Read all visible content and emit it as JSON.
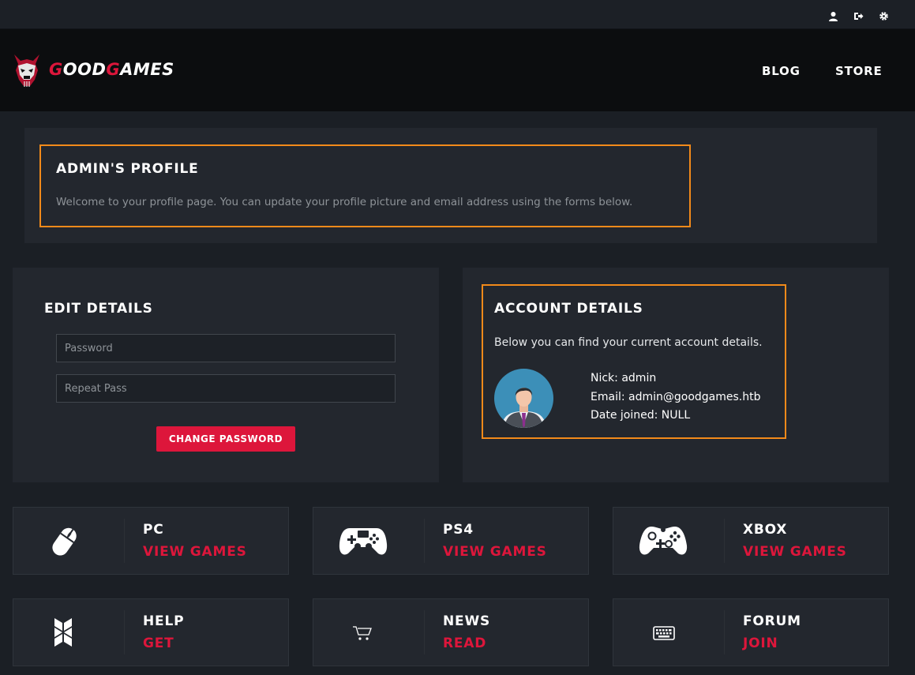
{
  "topbar": {
    "icons": [
      "user-icon",
      "logout-icon",
      "gear-icon"
    ]
  },
  "header": {
    "logo_text_1": "G",
    "logo_text_2": "OOD",
    "logo_text_3": "G",
    "logo_text_4": "AMES",
    "nav": [
      {
        "label": "BLOG"
      },
      {
        "label": "STORE"
      }
    ]
  },
  "profile": {
    "title": "ADMIN'S PROFILE",
    "welcome": "Welcome to your profile page. You can update your profile picture and email address using the forms below."
  },
  "edit": {
    "title": "EDIT DETAILS",
    "password_placeholder": "Password",
    "repeat_placeholder": "Repeat Pass",
    "button": "CHANGE PASSWORD"
  },
  "account": {
    "title": "ACCOUNT DETAILS",
    "subtitle": "Below you can find your current account details.",
    "nick": "Nick: admin",
    "email": "Email: admin@goodgames.htb",
    "joined": "Date joined: NULL"
  },
  "tiles": [
    {
      "title": "PC",
      "action": "VIEW GAMES",
      "icon": "mouse-icon"
    },
    {
      "title": "PS4",
      "action": "VIEW GAMES",
      "icon": "ps4-controller-icon"
    },
    {
      "title": "XBOX",
      "action": "VIEW GAMES",
      "icon": "xbox-controller-icon"
    },
    {
      "title": "HELP",
      "action": "GET",
      "icon": "help-icon"
    },
    {
      "title": "NEWS",
      "action": "READ",
      "icon": "cart-icon"
    },
    {
      "title": "FORUM",
      "action": "JOIN",
      "icon": "keyboard-icon"
    }
  ],
  "colors": {
    "accent": "#dd163b",
    "highlight": "#f28a1a",
    "panel": "#23272e",
    "background": "#1b1f25"
  }
}
